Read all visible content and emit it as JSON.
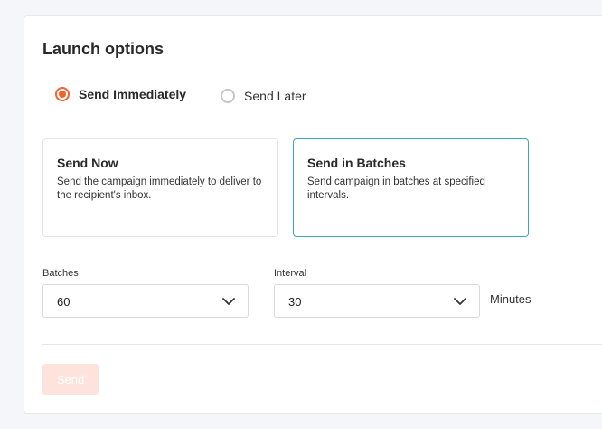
{
  "panel": {
    "title": "Launch options"
  },
  "schedule": {
    "options": [
      {
        "label": "Send Immediately",
        "selected": true
      },
      {
        "label": "Send Later",
        "selected": false
      }
    ]
  },
  "mode_cards": [
    {
      "title": "Send Now",
      "description": "Send the campaign immediately to deliver to the recipient's inbox.",
      "selected": false
    },
    {
      "title": "Send in Batches",
      "description": "Send campaign in batches at specified intervals.",
      "selected": true
    }
  ],
  "batch_settings": {
    "batches_label": "Batches",
    "batches_value": "60",
    "interval_label": "Interval",
    "interval_value": "30",
    "interval_unit": "Minutes"
  },
  "actions": {
    "send_label": "Send",
    "send_enabled": false
  },
  "colors": {
    "accent": "#f4622d",
    "selected_card_border": "#3aaab8",
    "disabled_button_bg": "#fde3dc"
  },
  "icons": {
    "select_arrow": "chevron-down-icon"
  }
}
